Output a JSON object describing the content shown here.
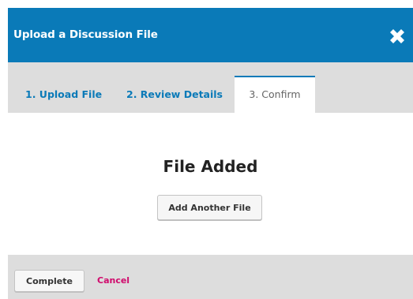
{
  "header": {
    "title": "Upload a Discussion File",
    "close_icon": "close-icon"
  },
  "tabs": [
    {
      "label": "1. Upload File",
      "active": false
    },
    {
      "label": "2. Review Details",
      "active": false
    },
    {
      "label": "3. Confirm",
      "active": true
    }
  ],
  "content": {
    "heading": "File Added",
    "add_another_label": "Add Another File"
  },
  "footer": {
    "complete_label": "Complete",
    "cancel_label": "Cancel"
  },
  "colors": {
    "header_bg": "#0a7ab8",
    "tab_bar_bg": "#dddddd",
    "link": "#0a7ab8",
    "cancel": "#d00a6c"
  }
}
